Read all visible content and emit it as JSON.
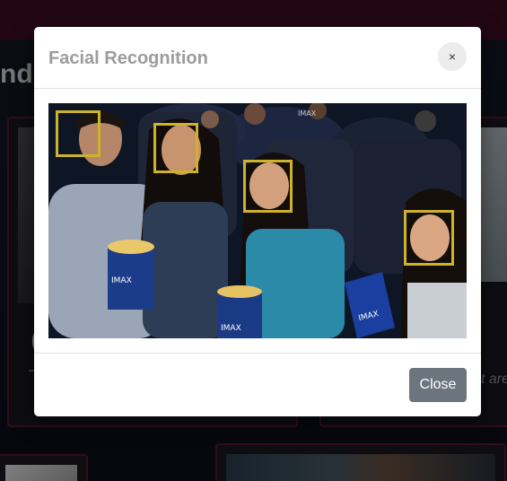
{
  "background": {
    "heading_fragment": "nd",
    "card_letter": "(",
    "card_text_tail": "t are"
  },
  "modal": {
    "title": "Facial Recognition",
    "close_icon": "×",
    "close_label": "Close",
    "image": {
      "description_icon": "theater-audience-photo",
      "badges": [
        "IMAX",
        "IMAX",
        "IMAX",
        "IMAX"
      ],
      "face_boxes_count": 4
    }
  },
  "colors": {
    "topbar": "#3f0d21",
    "card_border": "#5a1a2c",
    "face_box": "#cdb32b",
    "close_button": "#6c757d"
  }
}
